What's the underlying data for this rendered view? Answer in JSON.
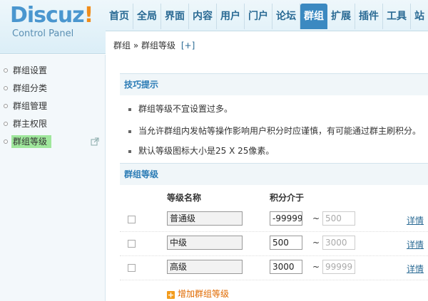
{
  "logo": {
    "brand": "Discuz",
    "bang": "!",
    "sub": "Control Panel"
  },
  "nav": [
    "首页",
    "全局",
    "界面",
    "内容",
    "用户",
    "门户",
    "论坛",
    "群组",
    "扩展",
    "插件",
    "工具",
    "站"
  ],
  "nav_active": "群组",
  "breadcrumb": {
    "root": "群组",
    "sep": "»",
    "current": "群组等级",
    "add": "[+]"
  },
  "sidebar": {
    "items": [
      {
        "label": "群组设置"
      },
      {
        "label": "群组分类"
      },
      {
        "label": "群组管理"
      },
      {
        "label": "群主权限"
      },
      {
        "label": "群组等级",
        "active": true
      }
    ]
  },
  "tips": {
    "title": "技巧提示",
    "items": [
      "群组等级不宜设置过多。",
      "当允许群组内发帖等操作影响用户积分时应谨慎，有可能通过群主刷积分。",
      "默认等级图标大小是25 X 25像素。"
    ]
  },
  "levels": {
    "title": "群组等级",
    "col_name": "等级名称",
    "col_range": "积分介于",
    "rows": [
      {
        "name": "普通级",
        "min": "-99999",
        "max": "500",
        "detail": "详情"
      },
      {
        "name": "中级",
        "min": "500",
        "max": "3000",
        "detail": "详情"
      },
      {
        "name": "高级",
        "min": "3000",
        "max": "99999",
        "detail": "详情"
      }
    ],
    "add_label": "增加群组等级"
  }
}
